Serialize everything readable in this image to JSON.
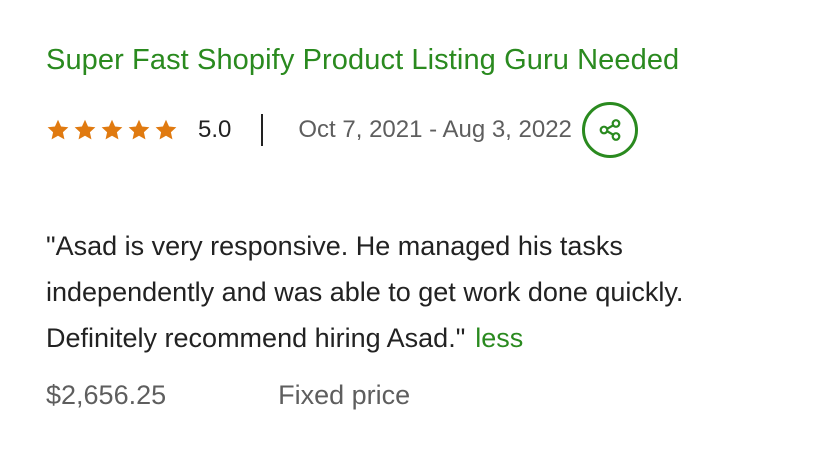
{
  "job": {
    "title": "Super Fast Shopify Product Listing Guru Needed",
    "stars": 5,
    "rating": "5.0",
    "separator": "|",
    "dates": "Oct 7, 2021 - Aug 3, 2022",
    "share_icon": "share-icon",
    "feedback": "\"Asad is very responsive. He managed his tasks independently and was able to get work done quickly. Definitely recommend hiring Asad.\"",
    "less_label": "less",
    "amount": "$2,656.25",
    "price_type": "Fixed price"
  },
  "colors": {
    "accent": "#2a8a1f",
    "star": "#e07a10",
    "text": "#222222",
    "muted": "#5e5e5e"
  }
}
